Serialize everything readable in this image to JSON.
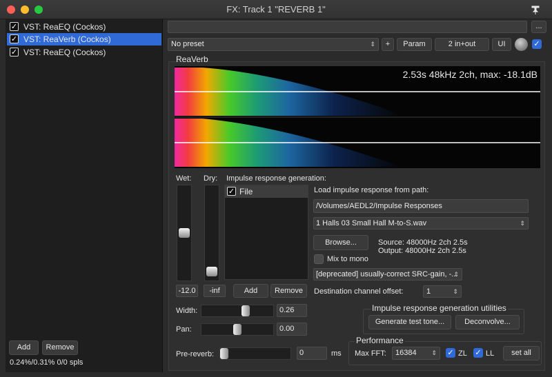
{
  "window": {
    "title": "FX: Track 1 \"REVERB 1\"",
    "pin_icon": "pin-icon"
  },
  "plugins": [
    {
      "label": "VST: ReaEQ (Cockos)",
      "selected": false
    },
    {
      "label": "VST: ReaVerb (Cockos)",
      "selected": true
    },
    {
      "label": "VST: ReaEQ (Cockos)",
      "selected": false
    }
  ],
  "left": {
    "add_label": "Add",
    "remove_label": "Remove",
    "status": "0.24%/0.31% 0/0 spls"
  },
  "toolbar": {
    "menu_label": "...",
    "preset": "No preset",
    "plus_label": "+",
    "param_label": "Param",
    "io_label": "2 in+out",
    "ui_label": "UI"
  },
  "plugin_name": "ReaVerb",
  "ir_info": "2.53s 48kHz 2ch, max: -18.1dB",
  "wet": {
    "label": "Wet:",
    "value": "-12.0",
    "level": 0.5
  },
  "dry": {
    "label": "Dry:",
    "value": "-inf",
    "level": 0.05
  },
  "irgen": {
    "title": "Impulse response generation:",
    "items": [
      {
        "label": "File",
        "checked": true
      }
    ],
    "add_label": "Add",
    "remove_label": "Remove"
  },
  "file": {
    "path_label": "Load impulse response from path:",
    "path": "/Volumes/AEDL2/Impulse Responses",
    "file_name": "1 Halls 03 Small Hall  M-to-S.wav",
    "browse_label": "Browse...",
    "source": "Source: 48000Hz 2ch 2.5s",
    "output": "Output: 48000Hz 2ch 2.5s",
    "mix_to_mono": "Mix to mono",
    "src_mode": "[deprecated] usually-correct SRC-gain, -...",
    "dest_offset_label": "Destination channel offset:",
    "dest_offset": "1"
  },
  "width": {
    "label": "Width:",
    "value": "0.26",
    "position": 0.63
  },
  "pan": {
    "label": "Pan:",
    "value": "0.00",
    "position": 0.5
  },
  "prereverb": {
    "label": "Pre-reverb:",
    "value": "0",
    "unit": "ms",
    "position": 0.0
  },
  "utils": {
    "title": "Impulse response generation utilities",
    "gen_tone": "Generate test tone...",
    "deconvolve": "Deconvolve..."
  },
  "performance": {
    "title": "Performance",
    "maxfft_label": "Max FFT:",
    "maxfft": "16384",
    "zl_label": "ZL",
    "ll_label": "LL",
    "setall_label": "set all"
  },
  "colors": {
    "accent": "#2f6ad6",
    "bg": "#2b2b2b",
    "close": "#ff5f57",
    "minimize": "#febc2e",
    "zoom": "#28c840"
  }
}
